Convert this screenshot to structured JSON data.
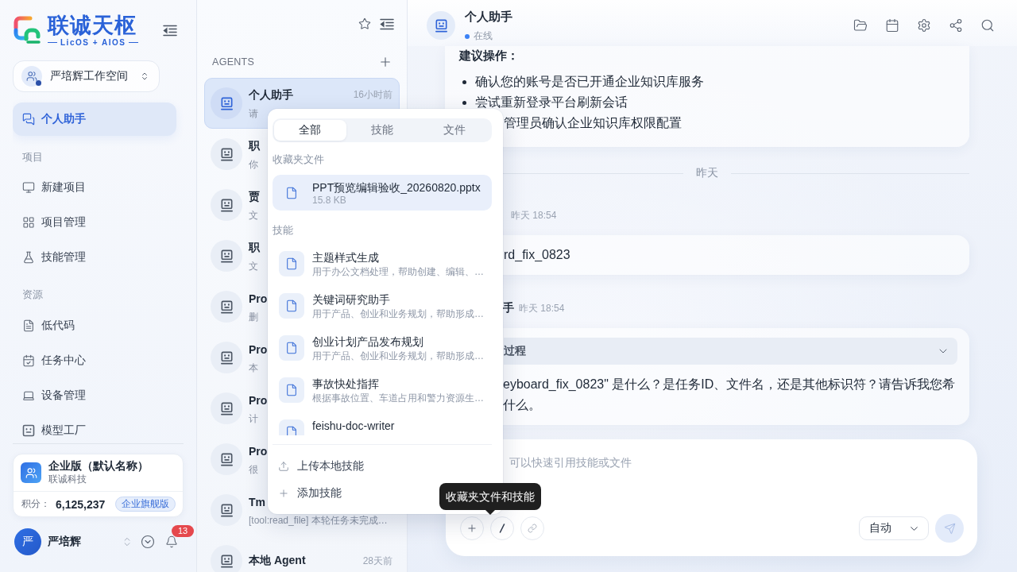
{
  "sidebar": {
    "brand": {
      "name": "联诚天枢",
      "tagline": "LicOS + AIOS"
    },
    "workspace": {
      "name": "严培辉工作空间"
    },
    "nav": [
      {
        "label": "个人助手",
        "selected": true
      }
    ],
    "sections": [
      {
        "title": "项目",
        "items": [
          {
            "label": "新建项目",
            "selected": false
          },
          {
            "label": "项目管理",
            "selected": false
          },
          {
            "label": "技能管理",
            "selected": false
          }
        ]
      },
      {
        "title": "资源",
        "items": [
          {
            "label": "低代码",
            "selected": false
          },
          {
            "label": "任务中心",
            "selected": false
          },
          {
            "label": "设备管理",
            "selected": false
          },
          {
            "label": "模型工厂",
            "selected": false
          }
        ]
      }
    ],
    "plan": {
      "name": "企业版（默认名称）",
      "company": "联诚科技",
      "points_label": "积分：",
      "points": "6,125,237",
      "badge": "企业旗舰版"
    },
    "user": {
      "initial": "严",
      "name": "严培辉",
      "notifications": "13"
    }
  },
  "agents": {
    "title": "AGENTS",
    "items": [
      {
        "name": "个人助手",
        "time": "16小时前",
        "preview": "请",
        "selected": true
      },
      {
        "name": "职",
        "preview": "你",
        "selected": false
      },
      {
        "name": "贾",
        "preview": "文",
        "selected": false
      },
      {
        "name": "职",
        "preview": "文",
        "selected": false
      },
      {
        "name": "Pro",
        "preview": "删",
        "selected": false
      },
      {
        "name": "Pro",
        "preview": "本",
        "selected": false
      },
      {
        "name": "Pro",
        "preview": "计",
        "selected": false
      },
      {
        "name": "Pro",
        "preview": "很",
        "selected": false
      },
      {
        "name": "Tm",
        "preview": "[tool:read_file] 本轮任务未完成…",
        "selected": false
      },
      {
        "name": "本地 Agent",
        "time": "28天前",
        "selected": false
      }
    ]
  },
  "popup": {
    "tabs": [
      {
        "label": "全部",
        "selected": true
      },
      {
        "label": "技能",
        "selected": false
      },
      {
        "label": "文件",
        "selected": false
      }
    ],
    "favorites_label": "收藏夹文件",
    "favorites": [
      {
        "name": "PPT预览编辑验收_20260820.pptx",
        "size": "15.8 KB",
        "selected": true
      }
    ],
    "skills_label": "技能",
    "skills": [
      {
        "name": "主题样式生成",
        "description": "用于办公文档处理，帮助创建、编辑、…"
      },
      {
        "name": "关键词研究助手",
        "description": "用于产品、创业和业务规划，帮助形成…"
      },
      {
        "name": "创业计划产品发布规划",
        "description": "用于产品、创业和业务规划，帮助形成…"
      },
      {
        "name": "事故快处指挥",
        "description": "根据事故位置、车道占用和警力资源生…"
      },
      {
        "name": "feishu-doc-writer"
      }
    ],
    "actions": [
      {
        "label": "上传本地技能"
      },
      {
        "label": "添加技能"
      }
    ]
  },
  "chat": {
    "header": {
      "title": "个人助手",
      "status": "在线",
      "online": true
    },
    "messages": [
      {
        "kind": "note",
        "heading": "建议操作：",
        "lines": [
          {
            "text": "确认您的账号是否已开通企业知识库服务",
            "marker": true
          },
          {
            "text": "尝试重新登录平台刷新会话",
            "marker": true
          },
          {
            "text": "管理员确认企业知识库权限配置",
            "marker": false
          }
        ]
      },
      {
        "kind": "date",
        "label": "昨天"
      },
      {
        "kind": "user",
        "time": "昨天 18:54",
        "text": "rd_fix_0823"
      },
      {
        "kind": "assistant",
        "author": "手",
        "time": "昨天 18:54",
        "thinking": "过程",
        "expanded": false,
        "lines": [
          "eyboard_fix_0823\" 是什么？是任务ID、文件名，还是其他标识符？请告诉我您希",
          "什么。"
        ]
      }
    ],
    "composer": {
      "placeholder": "可以快速引用技能或文件",
      "model": "自动",
      "send_disabled": true
    }
  },
  "tooltip": {
    "text": "收藏夹文件和技能"
  }
}
